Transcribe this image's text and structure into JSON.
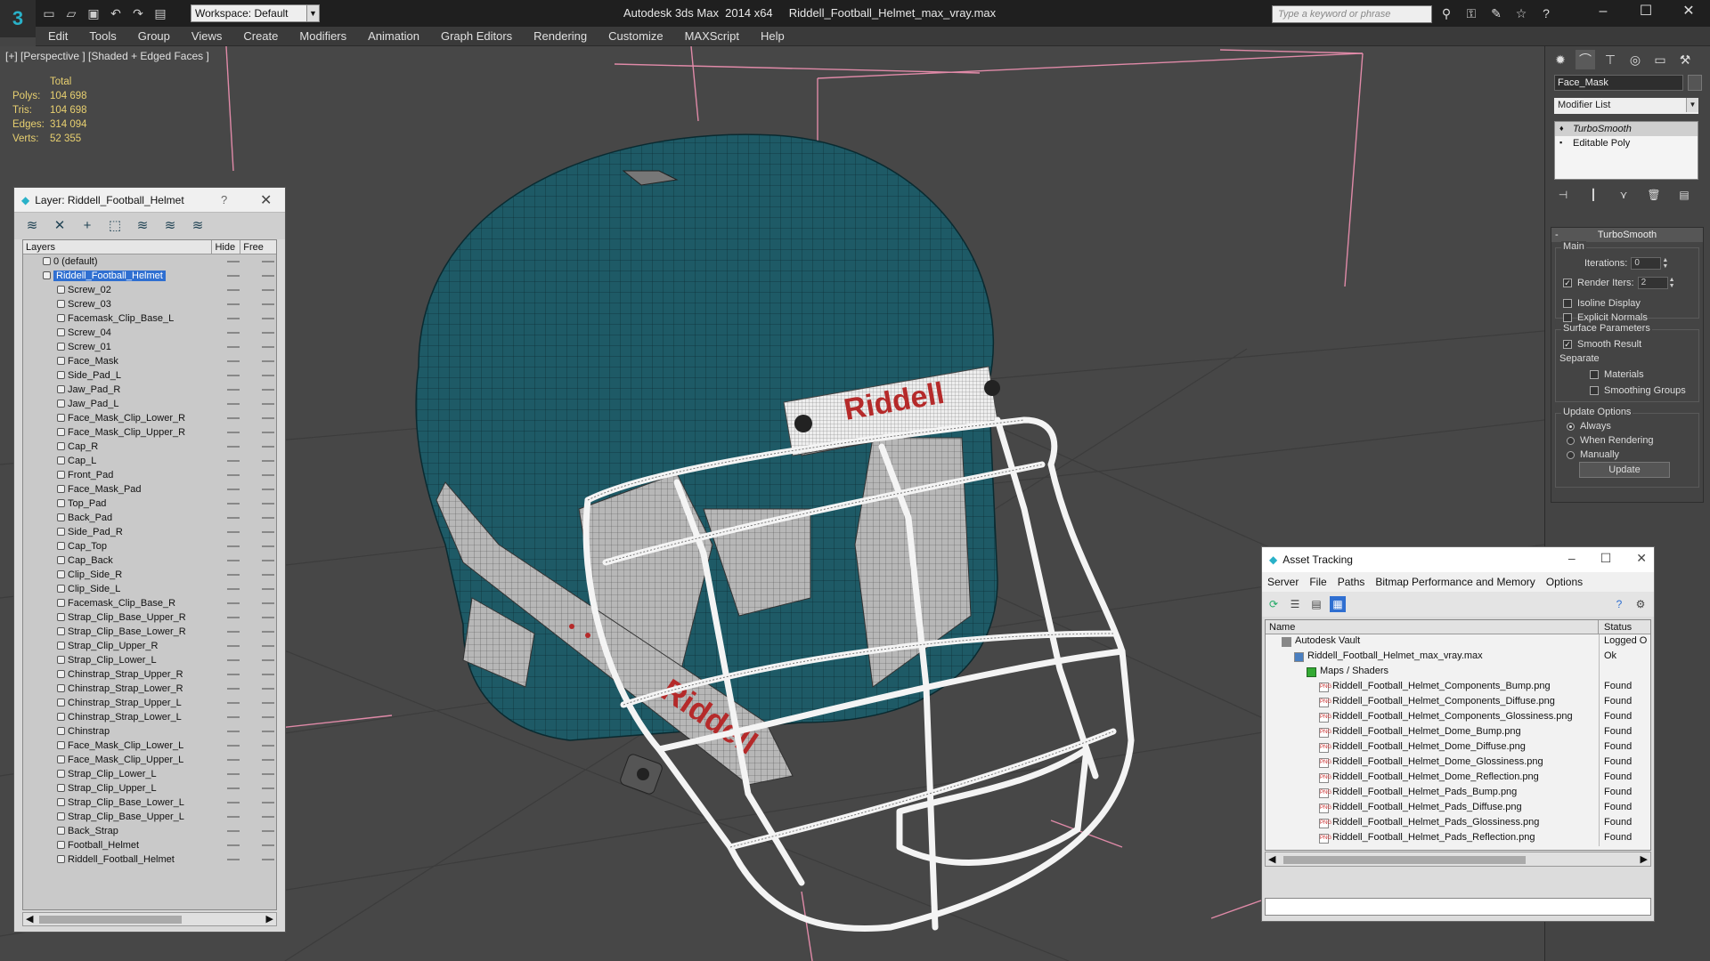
{
  "titlebar": {
    "app_title": "Autodesk 3ds Max  2014 x64     Riddell_Football_Helmet_max_vray.max",
    "workspace": "Workspace: Default",
    "search_placeholder": "Type a keyword or phrase",
    "logo_glyph": "3"
  },
  "menu": [
    "Edit",
    "Tools",
    "Group",
    "Views",
    "Create",
    "Modifiers",
    "Animation",
    "Graph Editors",
    "Rendering",
    "Customize",
    "MAXScript",
    "Help"
  ],
  "viewport": {
    "label": "[+] [Perspective ] [Shaded + Edged Faces ]",
    "stats": {
      "total_label": "Total",
      "rows": [
        {
          "k": "Polys:",
          "v": "104 698"
        },
        {
          "k": "Tris:",
          "v": "104 698"
        },
        {
          "k": "Edges:",
          "v": "314 094"
        },
        {
          "k": "Verts:",
          "v": "52 355"
        }
      ]
    },
    "helmet_logo_text": "Riddell",
    "side_logo_text": "Riddell"
  },
  "layer_panel": {
    "title": "Layer: Riddell_Football_Helmet",
    "help": "?",
    "close": "✕",
    "columns": {
      "layers": "Layers",
      "hide": "Hide",
      "freeze": "Free"
    },
    "layers": [
      {
        "name": "0 (default)",
        "level": 0
      },
      {
        "name": "Riddell_Football_Helmet",
        "level": 0,
        "selected": true
      },
      {
        "name": "Screw_02",
        "level": 1
      },
      {
        "name": "Screw_03",
        "level": 1
      },
      {
        "name": "Facemask_Clip_Base_L",
        "level": 1
      },
      {
        "name": "Screw_04",
        "level": 1
      },
      {
        "name": "Screw_01",
        "level": 1
      },
      {
        "name": "Face_Mask",
        "level": 1
      },
      {
        "name": "Side_Pad_L",
        "level": 1
      },
      {
        "name": "Jaw_Pad_R",
        "level": 1
      },
      {
        "name": "Jaw_Pad_L",
        "level": 1
      },
      {
        "name": "Face_Mask_Clip_Lower_R",
        "level": 1
      },
      {
        "name": "Face_Mask_Clip_Upper_R",
        "level": 1
      },
      {
        "name": "Cap_R",
        "level": 1
      },
      {
        "name": "Cap_L",
        "level": 1
      },
      {
        "name": "Front_Pad",
        "level": 1
      },
      {
        "name": "Face_Mask_Pad",
        "level": 1
      },
      {
        "name": "Top_Pad",
        "level": 1
      },
      {
        "name": "Back_Pad",
        "level": 1
      },
      {
        "name": "Side_Pad_R",
        "level": 1
      },
      {
        "name": "Cap_Top",
        "level": 1
      },
      {
        "name": "Cap_Back",
        "level": 1
      },
      {
        "name": "Clip_Side_R",
        "level": 1
      },
      {
        "name": "Clip_Side_L",
        "level": 1
      },
      {
        "name": "Facemask_Clip_Base_R",
        "level": 1
      },
      {
        "name": "Strap_Clip_Base_Upper_R",
        "level": 1
      },
      {
        "name": "Strap_Clip_Base_Lower_R",
        "level": 1
      },
      {
        "name": "Strap_Clip_Upper_R",
        "level": 1
      },
      {
        "name": "Strap_Clip_Lower_L",
        "level": 1
      },
      {
        "name": "Chinstrap_Strap_Upper_R",
        "level": 1
      },
      {
        "name": "Chinstrap_Strap_Lower_R",
        "level": 1
      },
      {
        "name": "Chinstrap_Strap_Upper_L",
        "level": 1
      },
      {
        "name": "Chinstrap_Strap_Lower_L",
        "level": 1
      },
      {
        "name": "Chinstrap",
        "level": 1
      },
      {
        "name": "Face_Mask_Clip_Lower_L",
        "level": 1
      },
      {
        "name": "Face_Mask_Clip_Upper_L",
        "level": 1
      },
      {
        "name": "Strap_Clip_Lower_L",
        "level": 1
      },
      {
        "name": "Strap_Clip_Upper_L",
        "level": 1
      },
      {
        "name": "Strap_Clip_Base_Lower_L",
        "level": 1
      },
      {
        "name": "Strap_Clip_Base_Upper_L",
        "level": 1
      },
      {
        "name": "Back_Strap",
        "level": 1
      },
      {
        "name": "Football_Helmet",
        "level": 1
      },
      {
        "name": "Riddell_Football_Helmet",
        "level": 1
      }
    ]
  },
  "command_panel": {
    "object_name": "Face_Mask",
    "modifier_list": "Modifier List",
    "stack": [
      {
        "name": "TurboSmooth",
        "selected": true
      },
      {
        "name": "Editable Poly",
        "selected": false
      }
    ],
    "turbosmooth": {
      "title": "TurboSmooth",
      "minus": "-",
      "main_label": "Main",
      "iterations_label": "Iterations:",
      "iterations_value": "0",
      "render_iters_label": "Render Iters:",
      "render_iters_value": "2",
      "render_iters_checked": true,
      "isoline_label": "Isoline Display",
      "explicit_normals_label": "Explicit Normals",
      "surface_label": "Surface Parameters",
      "smooth_result_label": "Smooth Result",
      "separate_label": "Separate",
      "materials_label": "Materials",
      "smoothing_groups_label": "Smoothing Groups",
      "update_options_label": "Update Options",
      "always_label": "Always",
      "when_rendering_label": "When Rendering",
      "manually_label": "Manually",
      "update_button": "Update"
    }
  },
  "asset_tracking": {
    "title": "Asset Tracking",
    "menu": [
      "Server",
      "File",
      "Paths",
      "Bitmap Performance and Memory",
      "Options"
    ],
    "col_name": "Name",
    "col_status": "Status",
    "rows": [
      {
        "name": "Autodesk Vault",
        "status": "Logged O",
        "indent": 0,
        "kind": "vault"
      },
      {
        "name": "Riddell_Football_Helmet_max_vray.max",
        "status": "Ok",
        "indent": 1,
        "kind": "max"
      },
      {
        "name": "Maps / Shaders",
        "status": "",
        "indent": 2,
        "kind": "folder"
      },
      {
        "name": "Riddell_Football_Helmet_Components_Bump.png",
        "status": "Found",
        "indent": 3,
        "kind": "png"
      },
      {
        "name": "Riddell_Football_Helmet_Components_Diffuse.png",
        "status": "Found",
        "indent": 3,
        "kind": "png"
      },
      {
        "name": "Riddell_Football_Helmet_Components_Glossiness.png",
        "status": "Found",
        "indent": 3,
        "kind": "png"
      },
      {
        "name": "Riddell_Football_Helmet_Dome_Bump.png",
        "status": "Found",
        "indent": 3,
        "kind": "png"
      },
      {
        "name": "Riddell_Football_Helmet_Dome_Diffuse.png",
        "status": "Found",
        "indent": 3,
        "kind": "png"
      },
      {
        "name": "Riddell_Football_Helmet_Dome_Glossiness.png",
        "status": "Found",
        "indent": 3,
        "kind": "png"
      },
      {
        "name": "Riddell_Football_Helmet_Dome_Reflection.png",
        "status": "Found",
        "indent": 3,
        "kind": "png"
      },
      {
        "name": "Riddell_Football_Helmet_Pads_Bump.png",
        "status": "Found",
        "indent": 3,
        "kind": "png"
      },
      {
        "name": "Riddell_Football_Helmet_Pads_Diffuse.png",
        "status": "Found",
        "indent": 3,
        "kind": "png"
      },
      {
        "name": "Riddell_Football_Helmet_Pads_Glossiness.png",
        "status": "Found",
        "indent": 3,
        "kind": "png"
      },
      {
        "name": "Riddell_Football_Helmet_Pads_Reflection.png",
        "status": "Found",
        "indent": 3,
        "kind": "png"
      }
    ]
  },
  "colors": {
    "helmet_shell": "#1e5a66",
    "stats_text": "#e8d070",
    "selection": "#2f6fd1",
    "logo_red": "#b52a2a"
  }
}
